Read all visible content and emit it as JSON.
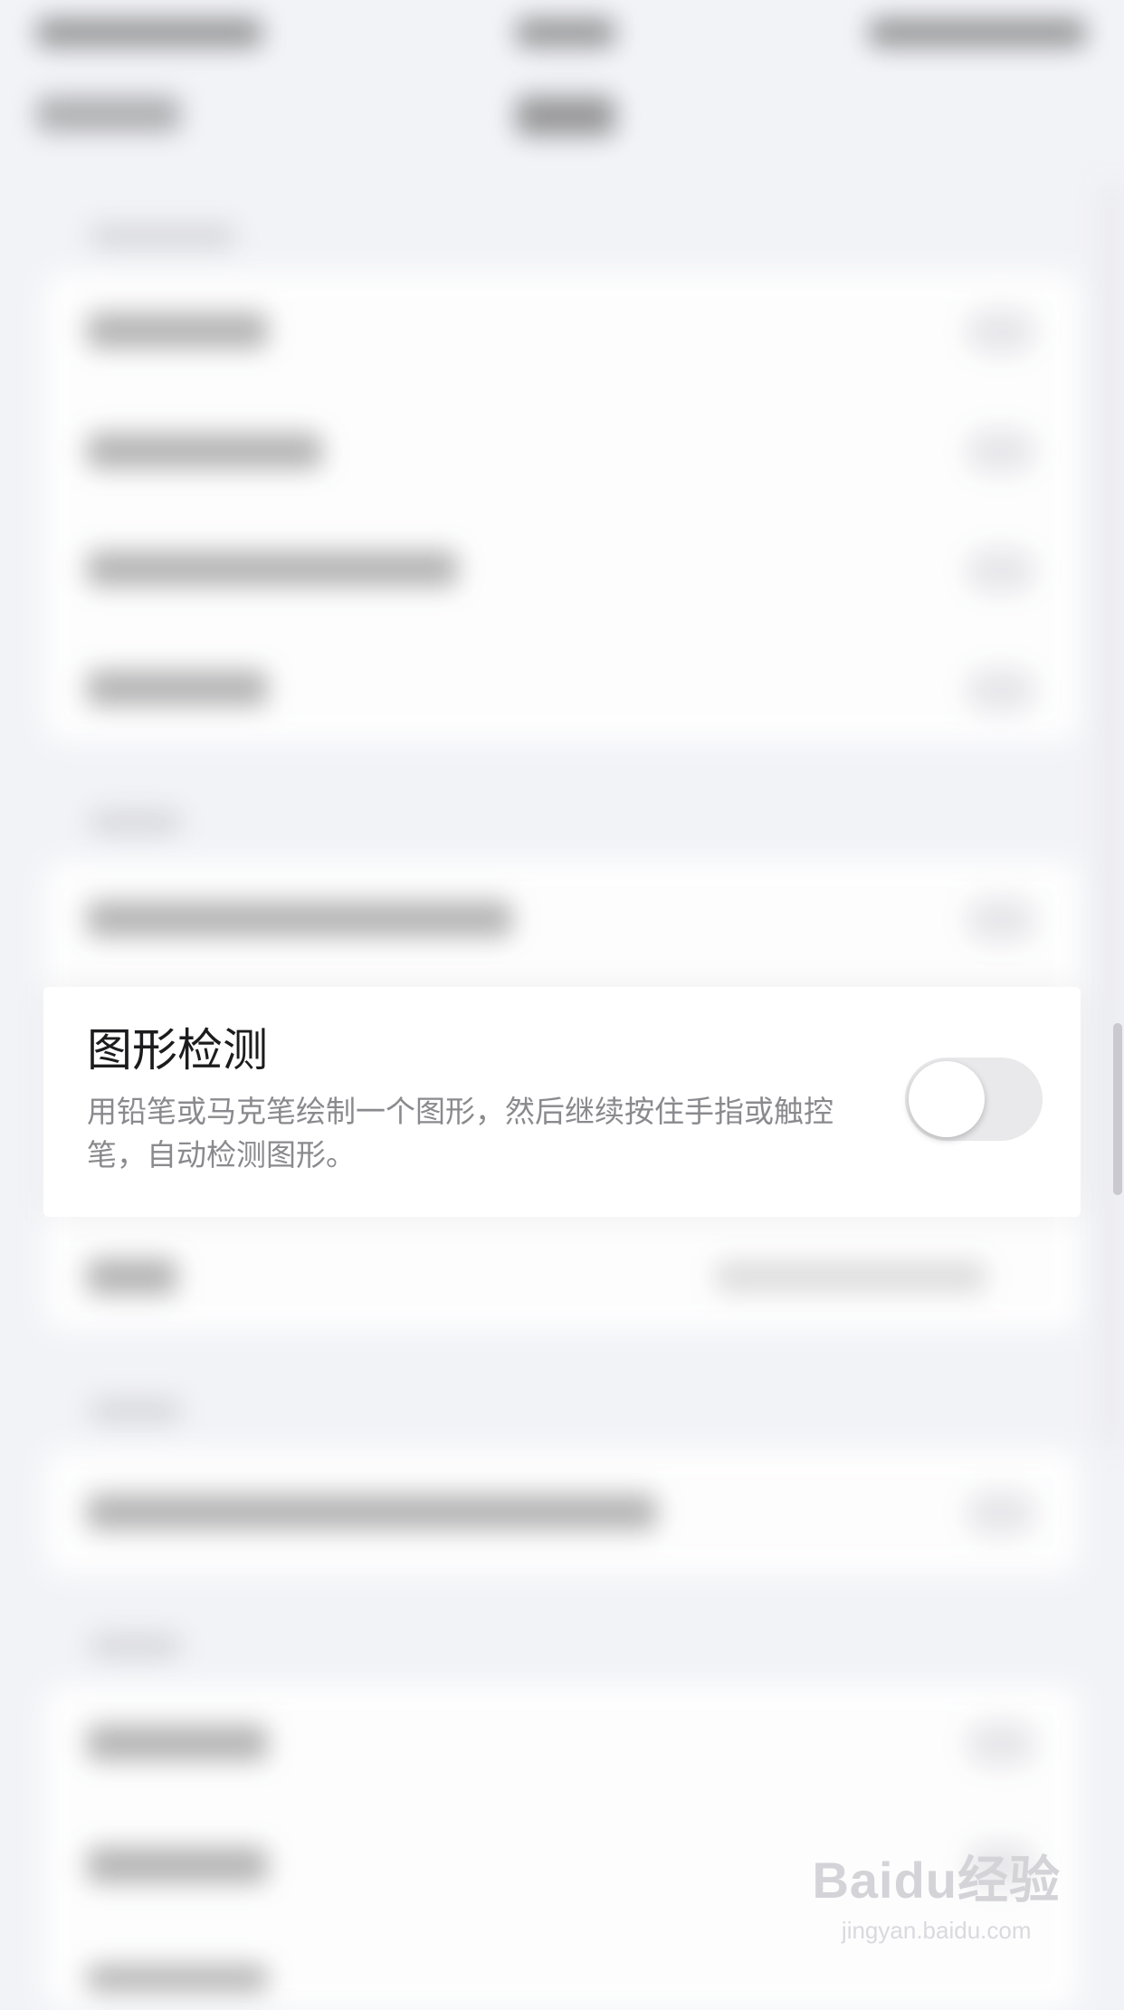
{
  "setting": {
    "title": "图形检测",
    "description": "用铅笔或马克笔绘制一个图形，然后继续按住手指或触控笔，自动检测图形。",
    "toggle_state": "off"
  },
  "watermark": {
    "logo": "Baidu经验",
    "url": "jingyan.baidu.com"
  }
}
